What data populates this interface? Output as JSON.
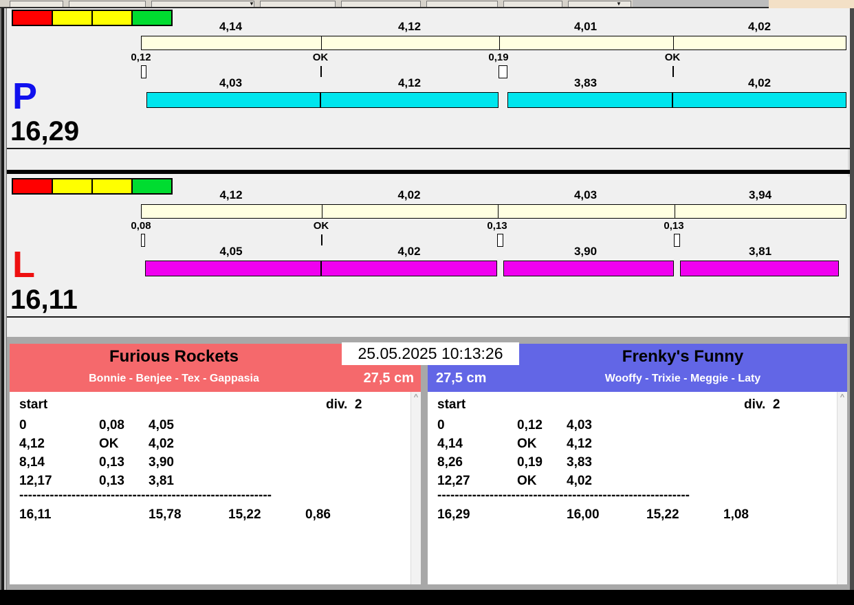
{
  "icons": {
    "scroll_up": "^",
    "dropdown": "▼"
  },
  "clock": "25.05.2025 10:13:26",
  "race_panels": [
    {
      "lane": "P",
      "lane_color": "#1010EE",
      "total": "16,29",
      "run_color": "#00E6EE",
      "lights": [
        "#FF0000",
        "#FFFF00",
        "#FFFF00",
        "#00DC30"
      ],
      "split_values": [
        "4,14",
        "4,12",
        "4,01",
        "4,02"
      ],
      "change_marks": [
        "0,12",
        "OK",
        "0,19",
        "OK"
      ],
      "run_values": [
        "4,03",
        "4,12",
        "3,83",
        "4,02"
      ]
    },
    {
      "lane": "L",
      "lane_color": "#EE1010",
      "total": "16,11",
      "run_color": "#F000F0",
      "lights": [
        "#FF0000",
        "#FFFF00",
        "#FFFF00",
        "#00DC30"
      ],
      "split_values": [
        "4,12",
        "4,02",
        "4,03",
        "3,94"
      ],
      "change_marks": [
        "0,08",
        "OK",
        "0,13",
        "0,13"
      ],
      "run_values": [
        "4,05",
        "4,02",
        "3,90",
        "3,81"
      ]
    }
  ],
  "teams": [
    {
      "name": "Furious Rockets",
      "dogs": "Bonnie - Benjee - Tex - Gappasia",
      "jump_height": "27,5 cm",
      "header_color": "#F5696C",
      "table": {
        "start_label": "start",
        "division_label": "div.  2",
        "rows": [
          [
            "0",
            "0,08",
            "4,05"
          ],
          [
            "4,12",
            "OK",
            "4,02"
          ],
          [
            "8,14",
            "0,13",
            "3,90"
          ],
          [
            "12,17",
            "0,13",
            "3,81"
          ]
        ],
        "separator": "----------------------------------------------------------",
        "totals": [
          "16,11",
          "15,78",
          "15,22",
          "0,86"
        ]
      }
    },
    {
      "name": "Frenky's Funny",
      "dogs": "Wooffy - Trixie - Meggie - Laty",
      "jump_height": "27,5 cm",
      "header_color": "#6266E6",
      "table": {
        "start_label": "start",
        "division_label": "div.  2",
        "rows": [
          [
            "0",
            "0,12",
            "4,03"
          ],
          [
            "4,14",
            "OK",
            "4,12"
          ],
          [
            "8,26",
            "0,19",
            "3,83"
          ],
          [
            "12,27",
            "OK",
            "4,02"
          ]
        ],
        "separator": "----------------------------------------------------------",
        "totals": [
          "16,29",
          "16,00",
          "15,22",
          "1,08"
        ]
      }
    }
  ]
}
